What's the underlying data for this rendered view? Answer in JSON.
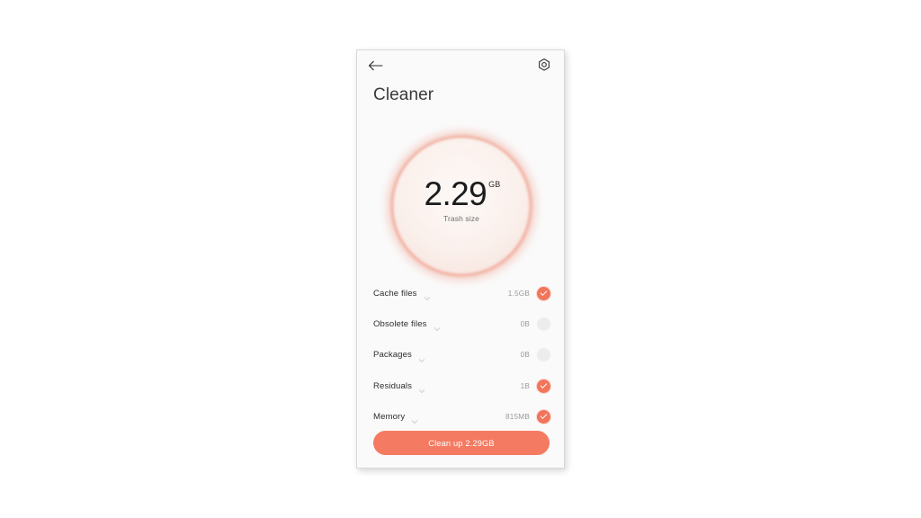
{
  "theme": {
    "accent": "#f2755b",
    "button": "#f47a62",
    "page_background": "#ffffff",
    "screen_background": "#fafafa",
    "ring": "#eb8068",
    "toggle_off": "#ededee",
    "text_primary": "#2f2f31",
    "text_secondary": "#9a9a9e"
  },
  "topbar": {
    "back_icon": "arrow-left-icon",
    "settings_icon": "gear-icon"
  },
  "header": {
    "title": "Cleaner"
  },
  "gauge": {
    "value": "2.29",
    "unit": "GB",
    "caption": "Trash size"
  },
  "list": {
    "items": [
      {
        "label": "Cache files",
        "size": "1.5GB",
        "checked": true
      },
      {
        "label": "Obsolete files",
        "size": "0B",
        "checked": false
      },
      {
        "label": "Packages",
        "size": "0B",
        "checked": false
      },
      {
        "label": "Residuals",
        "size": "1B",
        "checked": true
      },
      {
        "label": "Memory",
        "size": "815MB",
        "checked": true
      }
    ],
    "expand_icon": "chevron-down-icon"
  },
  "cta": {
    "label": "Clean up 2.29GB"
  }
}
